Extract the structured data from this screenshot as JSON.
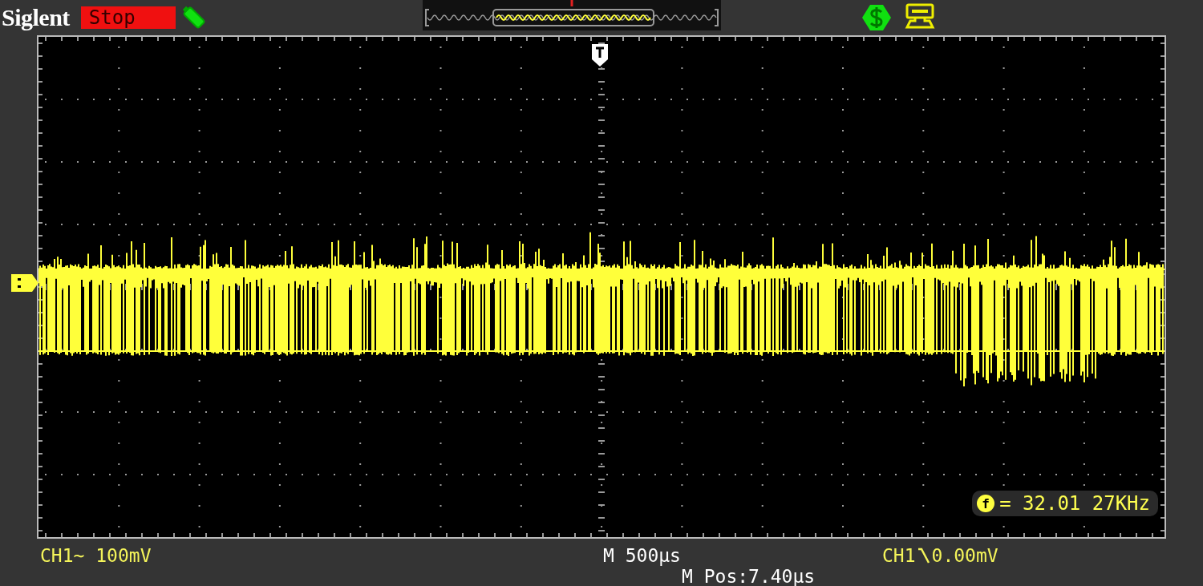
{
  "brand": "Siglent",
  "run_state": {
    "label": "Stop",
    "kind": "stop"
  },
  "frequency": {
    "symbol": "f",
    "value": "= 32.01 27KHz"
  },
  "channel": {
    "name": "CH1",
    "coupling": "∼",
    "scale": "100mV"
  },
  "timebase": {
    "scale": "M 500µs",
    "position": "M Pos:7.40µs"
  },
  "trigger": {
    "source": "CH1",
    "value": "0.00mV"
  }
}
